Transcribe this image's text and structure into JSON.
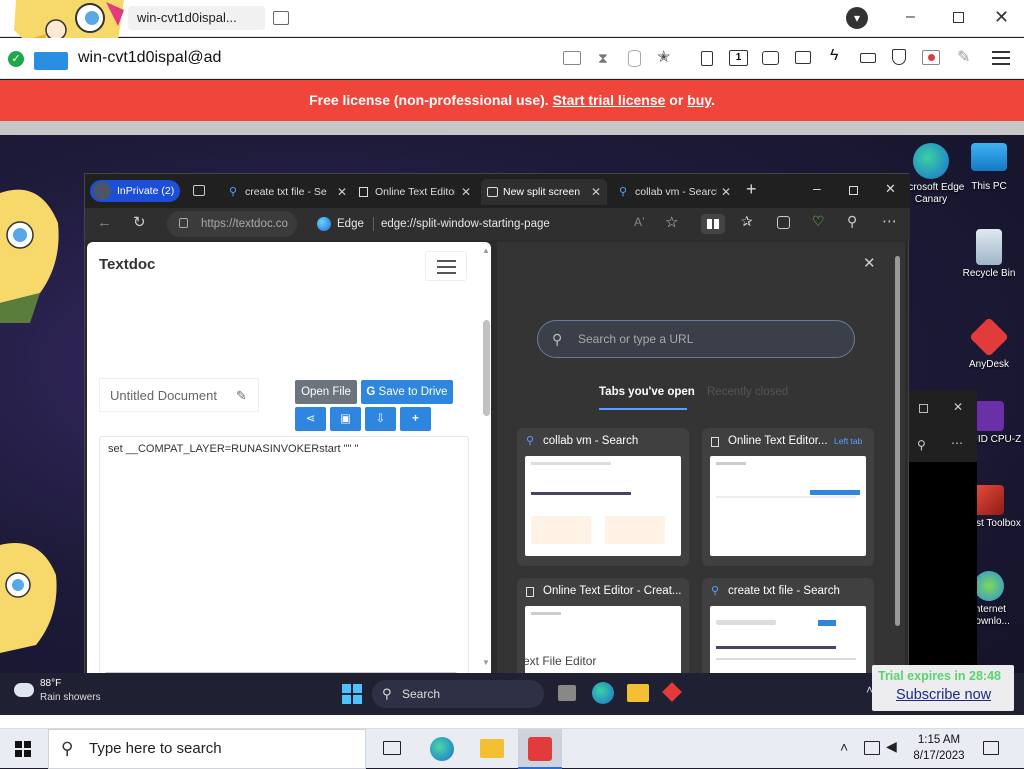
{
  "rd_client": {
    "tab_title": "win-cvt1d0ispal...",
    "connection_name": "win-cvt1d0ispal@ad"
  },
  "banner": {
    "prefix": "Free license (non-professional use).",
    "trial_link": "Start trial license",
    "or": "or",
    "buy_link": "buy",
    "suffix": "."
  },
  "edge": {
    "inprivate_label": "InPrivate (2)",
    "tabs": [
      {
        "label": "create txt file - Search"
      },
      {
        "label": "Online Text Editor"
      },
      {
        "label": "New split screen"
      },
      {
        "label": "collab vm - Search"
      }
    ],
    "address_short": "https://textdoc.co",
    "edge_label": "Edge",
    "url": "edge://split-window-starting-page"
  },
  "textdoc": {
    "logo": "Textdoc",
    "doc_name": "Untitled Document",
    "open_file": "Open File",
    "save_drive": "Save to Drive",
    "content": "set __COMPAT_LAYER=RUNASINVOKERstart \"\" \""
  },
  "split": {
    "search_placeholder": "Search or type a URL",
    "tab_open": "Tabs you've open",
    "tab_recent": "Recently closed",
    "cards": [
      {
        "title": "collab vm - Search"
      },
      {
        "title": "Online Text Editor...",
        "badge": "Left tab"
      },
      {
        "title": "Online Text Editor - Creat..."
      },
      {
        "title": "create txt file - Search"
      }
    ],
    "thumb_text_editor": "ext File Editor"
  },
  "desktop_icons": [
    {
      "label": "Microsoft Edge Canary"
    },
    {
      "label": "This PC"
    },
    {
      "label": "Recycle Bin"
    },
    {
      "label": "AnyDesk"
    },
    {
      "label": "CPUID CPU-Z"
    },
    {
      "label": "Ghost Toolbox"
    },
    {
      "label": "Internet Downlo..."
    }
  ],
  "remote_taskbar": {
    "weather_temp": "88°F",
    "weather_desc": "Rain showers",
    "search_label": "Search",
    "trial_text": "Trial expires in 28:48",
    "subscribe": "Subscribe now"
  },
  "local_taskbar": {
    "search_placeholder": "Type here to search",
    "time": "1:15 AM",
    "date": "8/17/2023"
  },
  "colors": {
    "banner_red": "#f0453a",
    "edge_accent": "#1d4ed8",
    "textdoc_blue": "#2e86de",
    "textdoc_gray": "#6c757d"
  }
}
